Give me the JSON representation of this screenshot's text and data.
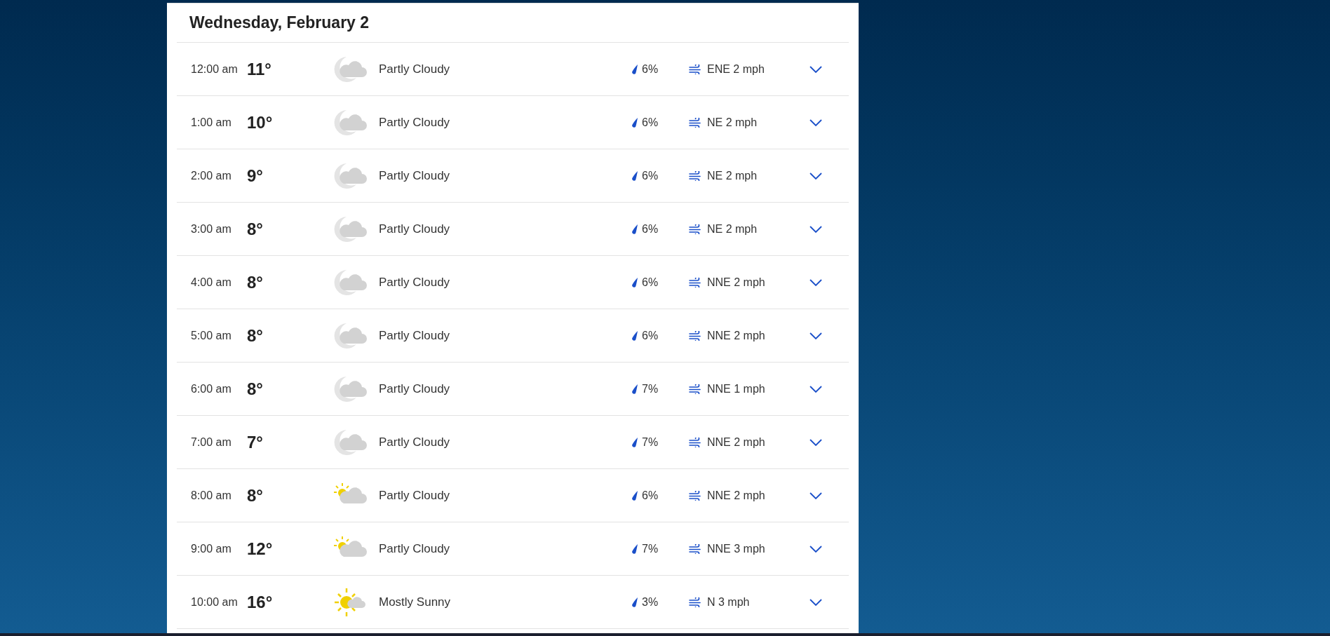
{
  "day_heading": "Wednesday, February 2",
  "hours": [
    {
      "time": "12:00 am",
      "temp": "11°",
      "kind": "night-cloud",
      "condition": "Partly Cloudy",
      "precip": "6%",
      "wind": "ENE 2 mph"
    },
    {
      "time": "1:00 am",
      "temp": "10°",
      "kind": "night-cloud",
      "condition": "Partly Cloudy",
      "precip": "6%",
      "wind": "NE 2 mph"
    },
    {
      "time": "2:00 am",
      "temp": "9°",
      "kind": "night-cloud",
      "condition": "Partly Cloudy",
      "precip": "6%",
      "wind": "NE 2 mph"
    },
    {
      "time": "3:00 am",
      "temp": "8°",
      "kind": "night-cloud",
      "condition": "Partly Cloudy",
      "precip": "6%",
      "wind": "NE 2 mph"
    },
    {
      "time": "4:00 am",
      "temp": "8°",
      "kind": "night-cloud",
      "condition": "Partly Cloudy",
      "precip": "6%",
      "wind": "NNE 2 mph"
    },
    {
      "time": "5:00 am",
      "temp": "8°",
      "kind": "night-cloud",
      "condition": "Partly Cloudy",
      "precip": "6%",
      "wind": "NNE 2 mph"
    },
    {
      "time": "6:00 am",
      "temp": "8°",
      "kind": "night-cloud",
      "condition": "Partly Cloudy",
      "precip": "7%",
      "wind": "NNE 1 mph"
    },
    {
      "time": "7:00 am",
      "temp": "7°",
      "kind": "night-cloud",
      "condition": "Partly Cloudy",
      "precip": "7%",
      "wind": "NNE 2 mph"
    },
    {
      "time": "8:00 am",
      "temp": "8°",
      "kind": "day-cloud",
      "condition": "Partly Cloudy",
      "precip": "6%",
      "wind": "NNE 2 mph"
    },
    {
      "time": "9:00 am",
      "temp": "12°",
      "kind": "day-cloud",
      "condition": "Partly Cloudy",
      "precip": "7%",
      "wind": "NNE 3 mph"
    },
    {
      "time": "10:00 am",
      "temp": "16°",
      "kind": "sun",
      "condition": "Mostly Sunny",
      "precip": "3%",
      "wind": "N 3 mph"
    }
  ]
}
